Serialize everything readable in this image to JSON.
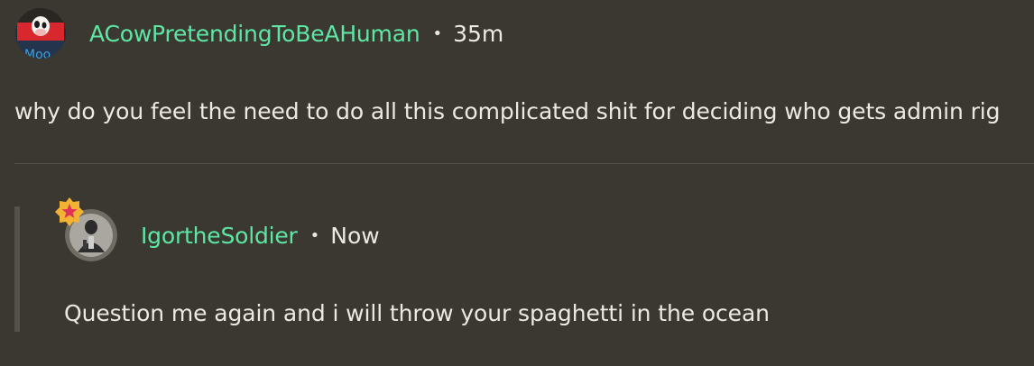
{
  "comment": {
    "username": "ACowPretendingToBeAHuman",
    "separator": "•",
    "timestamp": "35m",
    "text": "why do you feel the need to do all this complicated shit for deciding who gets admin rig",
    "avatar_icon": "cow-avatar-icon"
  },
  "reply": {
    "username": "IgortheSoldier",
    "separator": "•",
    "timestamp": "Now",
    "text": "Question me again and i will throw your spaghetti in the ocean",
    "avatar_icon": "soldier-avatar-icon",
    "badge_icon": "star-badge-icon"
  },
  "colors": {
    "background": "#3b3831",
    "username": "#5ee6a4",
    "text": "#ece9e2",
    "badge_outer": "#f2b233",
    "badge_star": "#e0325a"
  }
}
